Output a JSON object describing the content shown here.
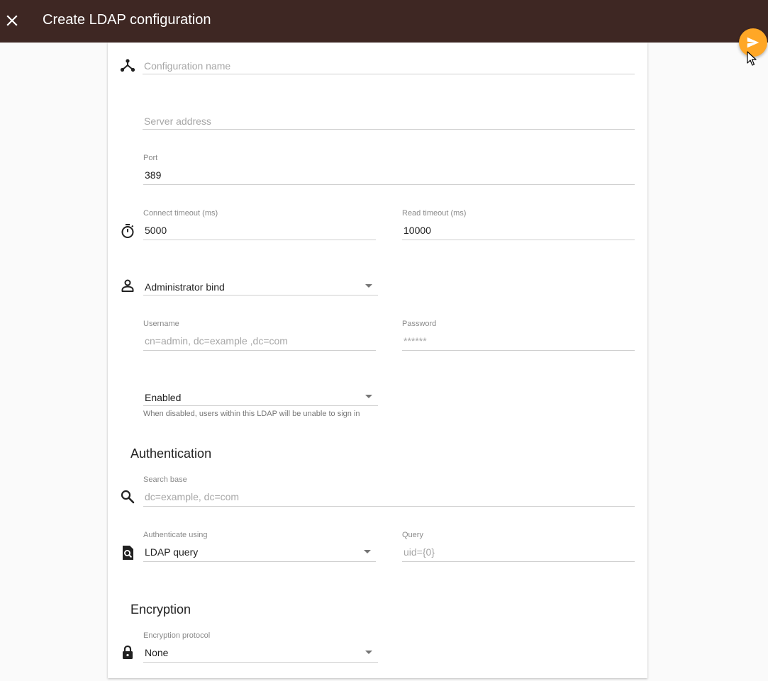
{
  "header": {
    "title": "Create LDAP configuration",
    "close_icon": "close-icon",
    "submit_icon": "send-icon"
  },
  "colors": {
    "appbar": "#3e2723",
    "fab": "#ffa726",
    "background": "#fafafa",
    "card": "#ffffff"
  },
  "form": {
    "config_name": {
      "placeholder": "Configuration name",
      "value": ""
    },
    "server_address": {
      "placeholder": "Server address",
      "value": ""
    },
    "port": {
      "label": "Port",
      "value": "389"
    },
    "connect_timeout": {
      "label": "Connect timeout (ms)",
      "value": "5000"
    },
    "read_timeout": {
      "label": "Read timeout (ms)",
      "value": "10000"
    },
    "bind_type": {
      "value": "Administrator bind"
    },
    "username": {
      "label": "Username",
      "placeholder": "cn=admin, dc=example ,dc=com"
    },
    "password": {
      "label": "Password",
      "placeholder": "******"
    },
    "status": {
      "value": "Enabled",
      "hint": "When disabled, users within this LDAP will be unable to sign in"
    }
  },
  "authentication": {
    "heading": "Authentication",
    "search_base": {
      "label": "Search base",
      "placeholder": "dc=example, dc=com"
    },
    "authenticate_using": {
      "label": "Authenticate using",
      "value": "LDAP query"
    },
    "query": {
      "label": "Query",
      "placeholder": "uid={0}"
    }
  },
  "encryption": {
    "heading": "Encryption",
    "protocol": {
      "label": "Encryption protocol",
      "value": "None"
    }
  }
}
